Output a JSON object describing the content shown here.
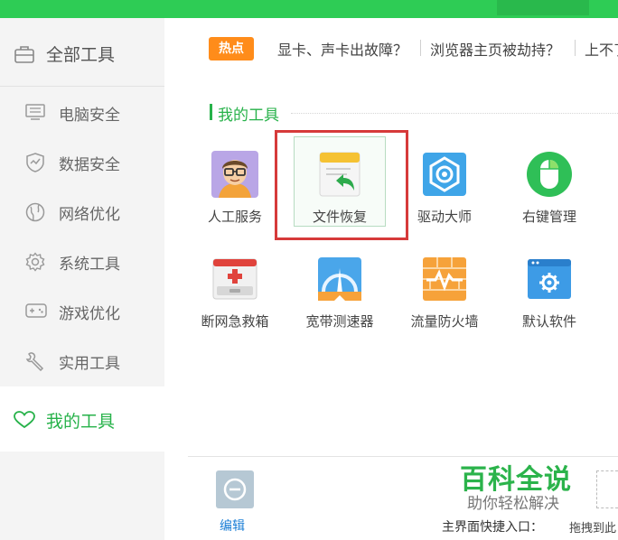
{
  "sidebar": {
    "header": {
      "label": "全部工具",
      "icon": "toolbox-icon"
    },
    "items": [
      {
        "label": "电脑安全",
        "icon": "monitor-icon"
      },
      {
        "label": "数据安全",
        "icon": "shield-icon"
      },
      {
        "label": "网络优化",
        "icon": "globe-icon"
      },
      {
        "label": "系统工具",
        "icon": "gear-icon"
      },
      {
        "label": "游戏优化",
        "icon": "gamepad-icon"
      },
      {
        "label": "实用工具",
        "icon": "wrench-icon"
      }
    ],
    "active": {
      "label": "我的工具",
      "icon": "heart-icon"
    }
  },
  "hot": {
    "badge": "热点",
    "links": [
      "显卡、声卡出故障？",
      "浏览器主页被劫持？",
      "上不了"
    ]
  },
  "section": {
    "title": "我的工具"
  },
  "tools": [
    {
      "label": "人工服务",
      "icon": "person-glasses-icon"
    },
    {
      "label": "文件恢复",
      "icon": "file-restore-icon"
    },
    {
      "label": "驱动大师",
      "icon": "driver-gear-icon"
    },
    {
      "label": "右键管理",
      "icon": "mouse-icon"
    },
    {
      "label": "断网急救箱",
      "icon": "first-aid-kit-icon"
    },
    {
      "label": "宽带测速器",
      "icon": "speedometer-icon"
    },
    {
      "label": "流量防火墙",
      "icon": "firewall-icon"
    },
    {
      "label": "默认软件",
      "icon": "default-software-icon"
    }
  ],
  "bottom": {
    "edit_label": "编辑",
    "brand_title": "百科全说",
    "brand_subtitle": "助你轻松解决",
    "shortcut_label": "主界面快捷入口：",
    "drag_hint": "拖拽到此"
  },
  "colors": {
    "accent": "#27b24a",
    "hot": "#ff8c1a",
    "selection": "#d63a3a",
    "link": "#1c7fd6"
  }
}
